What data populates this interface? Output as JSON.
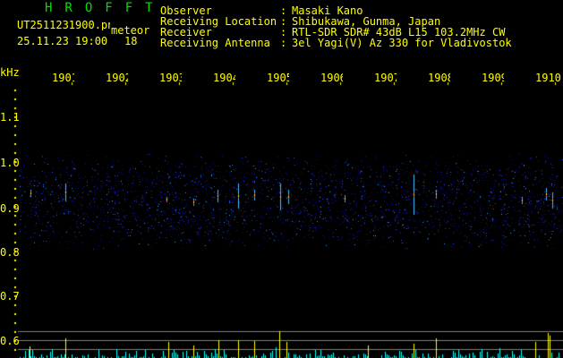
{
  "header": {
    "title": "HROFFT",
    "filename": "UT2511231900.png",
    "type": "meteor",
    "datetime": "25.11.23 19:00",
    "count": "18"
  },
  "info": {
    "rows": [
      {
        "label": "Observer",
        "value": "Masaki Kano"
      },
      {
        "label": "Receiving Location",
        "value": "Shibukawa, Gunma, Japan"
      },
      {
        "label": "Receiver",
        "value": "RTL-SDR SDR# 43dB L15 103.2MHz CW"
      },
      {
        "label": "Receiving Antenna",
        "value": "3el Yagi(V) Az 330 for Vladivostok"
      }
    ]
  },
  "axis": {
    "unit": "kHz",
    "time_labels": [
      "1901",
      "1902",
      "1903",
      "1904",
      "1905",
      "1906",
      "1907",
      "1908",
      "1909",
      "1910"
    ],
    "freq_labels": [
      "1.1",
      "1.0",
      "0.9",
      "0.8",
      "0.7",
      "0.6"
    ]
  },
  "colors": {
    "text": "#ffff00",
    "title": "#00e000",
    "bars": "#00ffff",
    "echo": "#ffff00",
    "grid": "#808080"
  }
}
